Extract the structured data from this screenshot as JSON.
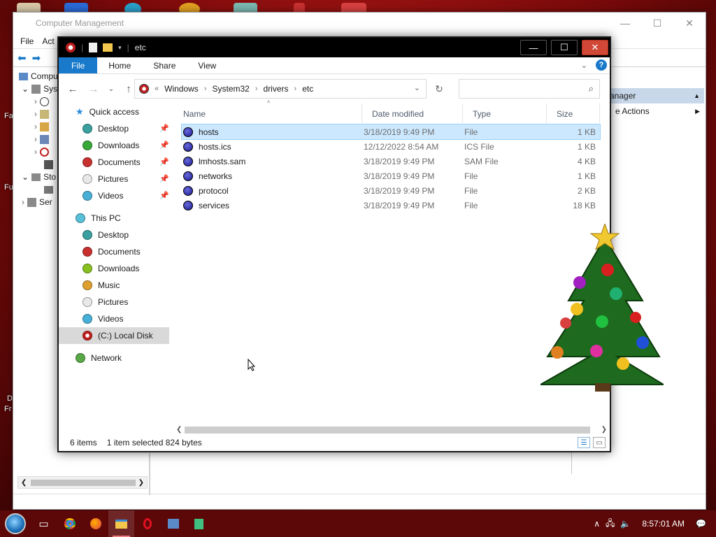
{
  "cm": {
    "title": "Computer Management",
    "menu": [
      "File",
      "Act"
    ],
    "tree": [
      "Compu",
      "Sys",
      "",
      "",
      "",
      "",
      "",
      "Sto",
      "",
      "Ser"
    ],
    "actions_header": "anager",
    "actions_row": "e Actions"
  },
  "desktop_fragments": [
    "Fa",
    "Fu",
    "D",
    "Fr"
  ],
  "explorer": {
    "title": "etc",
    "ribbon_tabs": [
      "File",
      "Home",
      "Share",
      "View"
    ],
    "help": "?",
    "breadcrumb": [
      "Windows",
      "System32",
      "drivers",
      "etc"
    ],
    "breadcrumb_prefix": "«",
    "search_placeholder": "",
    "columns": [
      "Name",
      "Date modified",
      "Type",
      "Size"
    ],
    "files": [
      {
        "name": "hosts",
        "date": "3/18/2019 9:49 PM",
        "type": "File",
        "size": "1 KB",
        "selected": true
      },
      {
        "name": "hosts.ics",
        "date": "12/12/2022 8:54 AM",
        "type": "ICS File",
        "size": "1 KB",
        "selected": false
      },
      {
        "name": "lmhosts.sam",
        "date": "3/18/2019 9:49 PM",
        "type": "SAM File",
        "size": "4 KB",
        "selected": false
      },
      {
        "name": "networks",
        "date": "3/18/2019 9:49 PM",
        "type": "File",
        "size": "1 KB",
        "selected": false
      },
      {
        "name": "protocol",
        "date": "3/18/2019 9:49 PM",
        "type": "File",
        "size": "2 KB",
        "selected": false
      },
      {
        "name": "services",
        "date": "3/18/2019 9:49 PM",
        "type": "File",
        "size": "18 KB",
        "selected": false
      }
    ],
    "status": {
      "items": "6 items",
      "selected": "1 item selected",
      "bytes": "824 bytes"
    },
    "nav": {
      "quick_access": "Quick access",
      "quick_items": [
        "Desktop",
        "Downloads",
        "Documents",
        "Pictures",
        "Videos"
      ],
      "this_pc": "This PC",
      "pc_items": [
        "Desktop",
        "Documents",
        "Downloads",
        "Music",
        "Pictures",
        "Videos",
        "(C:) Local Disk"
      ],
      "network": "Network"
    }
  },
  "taskbar": {
    "clock": "8:57:01 AM"
  },
  "colors": {
    "accent": "#1979ca",
    "selection": "#cce8ff",
    "desktop": "#9a1010"
  }
}
